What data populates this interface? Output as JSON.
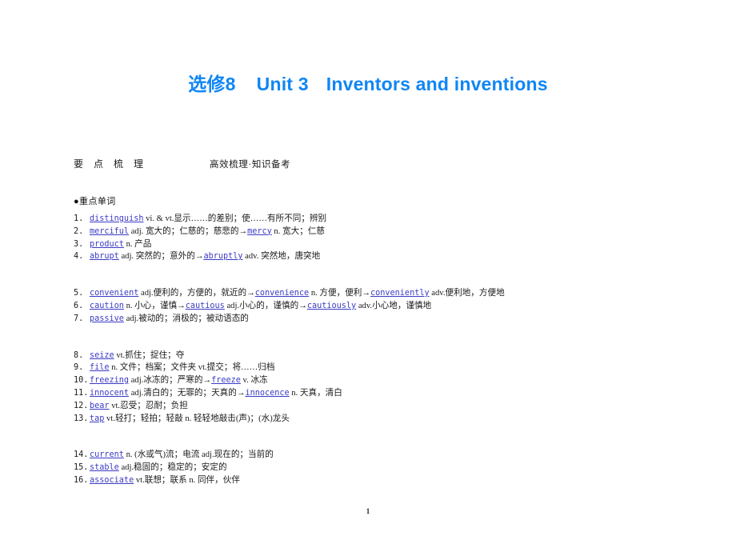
{
  "document": {
    "title_parts": {
      "book": "选修8",
      "unit": "Unit 3",
      "topic": "Inventors and inventions"
    },
    "title_color": "#0f86f5",
    "page_number": "1"
  },
  "section_header": {
    "primary": "要 点 梳 理",
    "secondary": "高效梳理·知识备考"
  },
  "vocabulary": {
    "heading": "●重点单词",
    "groups": [
      {
        "entries": [
          {
            "num": "1.",
            "word": "distinguish",
            "body": " vi. & vt.显示……的差别；使……有所不同；辨别"
          },
          {
            "num": "2.",
            "word": "merciful",
            "body": " adj. 宽大的；仁慈的；慈悲的→",
            "word2": "mercy",
            "body2": " n. 宽大；仁慈"
          },
          {
            "num": "3.",
            "word": "product",
            "body": " n. 产品"
          },
          {
            "num": "4.",
            "word": "abrupt",
            "body": " adj. 突然的；意外的→",
            "word2": "abruptly",
            "body2": " adv. 突然地，唐突地"
          }
        ]
      },
      {
        "entries": [
          {
            "num": "5.",
            "word": "convenient",
            "body": " adj.便利的，方便的，就近的→",
            "word2": "convenience",
            "body2": " n. 方便，便利→",
            "word3": "conveniently",
            "body3": " adv.便利地，方便地"
          },
          {
            "num": "6.",
            "word": "caution",
            "body": " n. 小心，谨慎→",
            "word2": "cautious",
            "body2": " adj.小心的，谨慎的→",
            "word3": "cautiously",
            "body3": " adv.小心地，谨慎地"
          },
          {
            "num": "7.",
            "word": "passive",
            "body": " adj.被动的；消极的；被动语态的"
          }
        ]
      },
      {
        "entries": [
          {
            "num": "8.",
            "word": "seize",
            "body": " vt.抓住；捉住；夺"
          },
          {
            "num": "9.",
            "word": "file",
            "body": " n. 文件；档案；文件夹 vt.提交；将……归档"
          },
          {
            "num": "10.",
            "word": "freezing",
            "body": " adj.冰冻的；严寒的→",
            "word2": "freeze",
            "body2": " v. 冰冻"
          },
          {
            "num": "11.",
            "word": "innocent",
            "body": " adj.清白的；无罪的；天真的→",
            "word2": "innocence",
            "body2": " n. 天真，清白"
          },
          {
            "num": "12.",
            "word": "bear",
            "body": " vt.忍受；忍耐；负担"
          },
          {
            "num": "13.",
            "word": "tap",
            "body": " vt.轻打；轻拍；轻敲 n. 轻轻地敲击(声)；(水)龙头"
          }
        ]
      },
      {
        "entries": [
          {
            "num": "14.",
            "word": "current",
            "body": " n. (水或气)流；电流 adj.现在的；当前的"
          },
          {
            "num": "15.",
            "word": "stable",
            "body": " adj.稳固的；稳定的；安定的"
          },
          {
            "num": "16.",
            "word": "associate",
            "body": " vt.联想；联系 n. 同伴，伙伴"
          }
        ]
      }
    ]
  }
}
